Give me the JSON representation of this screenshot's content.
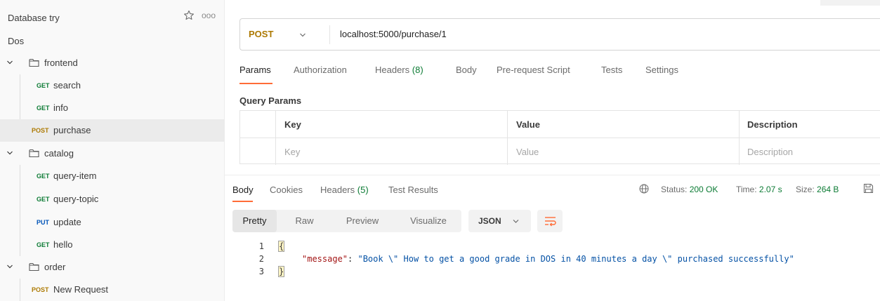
{
  "sidebar": {
    "title": "Database try",
    "more_glyph": "ooo",
    "collection_name": "Dos",
    "folders": [
      {
        "name": "frontend",
        "requests": [
          {
            "method": "GET",
            "name": "search"
          },
          {
            "method": "GET",
            "name": "info"
          },
          {
            "method": "POST",
            "name": "purchase",
            "selected": true
          }
        ]
      },
      {
        "name": "catalog",
        "requests": [
          {
            "method": "GET",
            "name": "query-item"
          },
          {
            "method": "GET",
            "name": "query-topic"
          },
          {
            "method": "PUT",
            "name": "update"
          },
          {
            "method": "GET",
            "name": "hello"
          }
        ]
      },
      {
        "name": "order",
        "requests": [
          {
            "method": "POST",
            "name": "New Request"
          }
        ]
      }
    ]
  },
  "request": {
    "method": "POST",
    "url": "localhost:5000/purchase/1",
    "tabs": {
      "params": "Params",
      "authorization": "Authorization",
      "headers": "Headers",
      "headers_count": "(8)",
      "body": "Body",
      "prerequest": "Pre-request Script",
      "tests": "Tests",
      "settings": "Settings"
    },
    "query_params_title": "Query Params",
    "params_table": {
      "headers": [
        "Key",
        "Value",
        "Description"
      ],
      "placeholders": [
        "Key",
        "Value",
        "Description"
      ]
    }
  },
  "response": {
    "tabs": {
      "body": "Body",
      "cookies": "Cookies",
      "headers": "Headers",
      "headers_count": "(5)",
      "test_results": "Test Results"
    },
    "status_label": "Status:",
    "status_value": "200 OK",
    "time_label": "Time:",
    "time_value": "2.07 s",
    "size_label": "Size:",
    "size_value": "264 B",
    "view_modes": [
      "Pretty",
      "Raw",
      "Preview",
      "Visualize"
    ],
    "format": "JSON",
    "line_numbers": [
      "1",
      "2",
      "3"
    ],
    "body_open": "{",
    "body_key": "\"message\"",
    "body_colon": ": ",
    "body_value": "\"Book \\\" How to get a good grade in DOS in 40 minutes a day \\\" purchased successfully\"",
    "body_close": "}"
  },
  "colors": {
    "accent": "#ff6c37",
    "get": "#0c7b34",
    "post": "#ad7a03",
    "put": "#0053b8",
    "status_ok": "#0c7b34"
  }
}
